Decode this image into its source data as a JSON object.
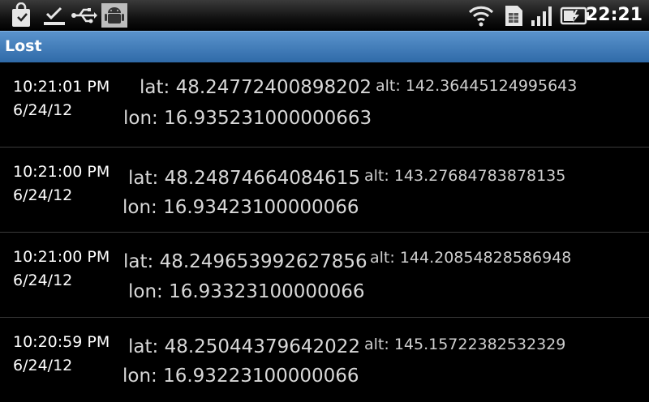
{
  "statusbar": {
    "icons_left": [
      "shopping-bag-icon",
      "download-complete-icon",
      "usb-icon",
      "android-debug-icon"
    ],
    "icons_right": [
      "wifi-icon",
      "sim-card-icon",
      "signal-bars-icon",
      "battery-charging-icon"
    ],
    "clock": "22:21"
  },
  "app": {
    "title": "Lost"
  },
  "entries": [
    {
      "time": "10:21:01 PM",
      "date": "6/24/12",
      "lat": "lat: 48.24772400898202",
      "lon": "lon: 16.935231000000663",
      "alt": "alt: 142.36445124995643"
    },
    {
      "time": "10:21:00 PM",
      "date": "6/24/12",
      "lat": "lat: 48.24874664084615",
      "lon": "lon: 16.93423100000066",
      "alt": "alt: 143.27684783878135"
    },
    {
      "time": "10:21:00 PM",
      "date": "6/24/12",
      "lat": "lat: 48.249653992627856",
      "lon": "lon: 16.93323100000066",
      "alt": "alt: 144.20854828586948"
    },
    {
      "time": "10:20:59 PM",
      "date": "6/24/12",
      "lat": "lat: 48.25044379642022",
      "lon": "lon: 16.93223100000066",
      "alt": "alt: 145.15722382532329"
    }
  ]
}
